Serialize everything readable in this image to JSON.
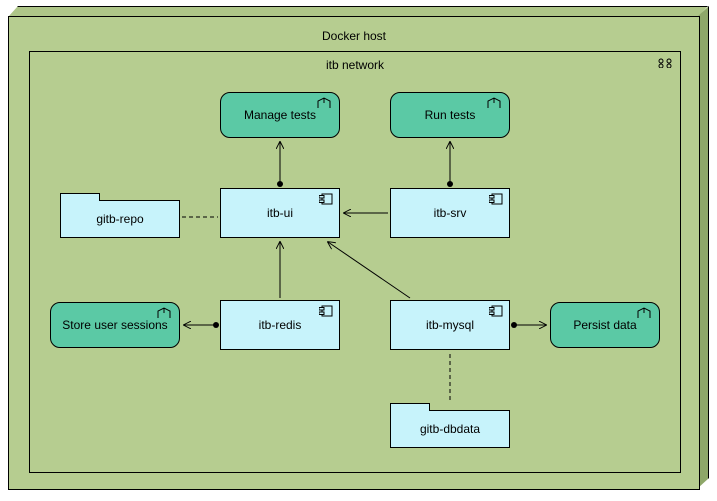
{
  "host": {
    "title": "Docker host"
  },
  "network": {
    "title": "itb network"
  },
  "goals": {
    "manage_tests": "Manage tests",
    "run_tests": "Run tests",
    "store_sessions": "Store user sessions",
    "persist_data": "Persist data"
  },
  "components": {
    "itb_ui": "itb-ui",
    "itb_srv": "itb-srv",
    "itb_redis": "itb-redis",
    "itb_mysql": "itb-mysql"
  },
  "artifacts": {
    "gitb_repo": "gitb-repo",
    "gitb_dbdata": "gitb-dbdata"
  },
  "chart_data": {
    "type": "diagram",
    "notation": "ArchiMate",
    "containers": [
      {
        "id": "docker-host",
        "label": "Docker host",
        "type": "node"
      },
      {
        "id": "itb-network",
        "label": "itb network",
        "type": "network",
        "parent": "docker-host"
      }
    ],
    "nodes": [
      {
        "id": "manage-tests",
        "label": "Manage tests",
        "type": "goal",
        "parent": "itb-network"
      },
      {
        "id": "run-tests",
        "label": "Run tests",
        "type": "goal",
        "parent": "itb-network"
      },
      {
        "id": "store-sessions",
        "label": "Store user sessions",
        "type": "goal",
        "parent": "itb-network"
      },
      {
        "id": "persist-data",
        "label": "Persist data",
        "type": "goal",
        "parent": "itb-network"
      },
      {
        "id": "itb-ui",
        "label": "itb-ui",
        "type": "application-component",
        "parent": "itb-network"
      },
      {
        "id": "itb-srv",
        "label": "itb-srv",
        "type": "application-component",
        "parent": "itb-network"
      },
      {
        "id": "itb-redis",
        "label": "itb-redis",
        "type": "application-component",
        "parent": "itb-network"
      },
      {
        "id": "itb-mysql",
        "label": "itb-mysql",
        "type": "application-component",
        "parent": "itb-network"
      },
      {
        "id": "gitb-repo",
        "label": "gitb-repo",
        "type": "artifact",
        "parent": "itb-network"
      },
      {
        "id": "gitb-dbdata",
        "label": "gitb-dbdata",
        "type": "artifact",
        "parent": "itb-network"
      }
    ],
    "edges": [
      {
        "from": "itb-ui",
        "to": "manage-tests",
        "type": "realization"
      },
      {
        "from": "itb-srv",
        "to": "run-tests",
        "type": "realization"
      },
      {
        "from": "itb-redis",
        "to": "store-sessions",
        "type": "realization"
      },
      {
        "from": "itb-mysql",
        "to": "persist-data",
        "type": "realization"
      },
      {
        "from": "itb-srv",
        "to": "itb-ui",
        "type": "serving"
      },
      {
        "from": "itb-redis",
        "to": "itb-ui",
        "type": "serving"
      },
      {
        "from": "itb-mysql",
        "to": "itb-ui",
        "type": "serving"
      },
      {
        "from": "gitb-repo",
        "to": "itb-ui",
        "type": "association"
      },
      {
        "from": "gitb-dbdata",
        "to": "itb-mysql",
        "type": "association"
      }
    ]
  }
}
